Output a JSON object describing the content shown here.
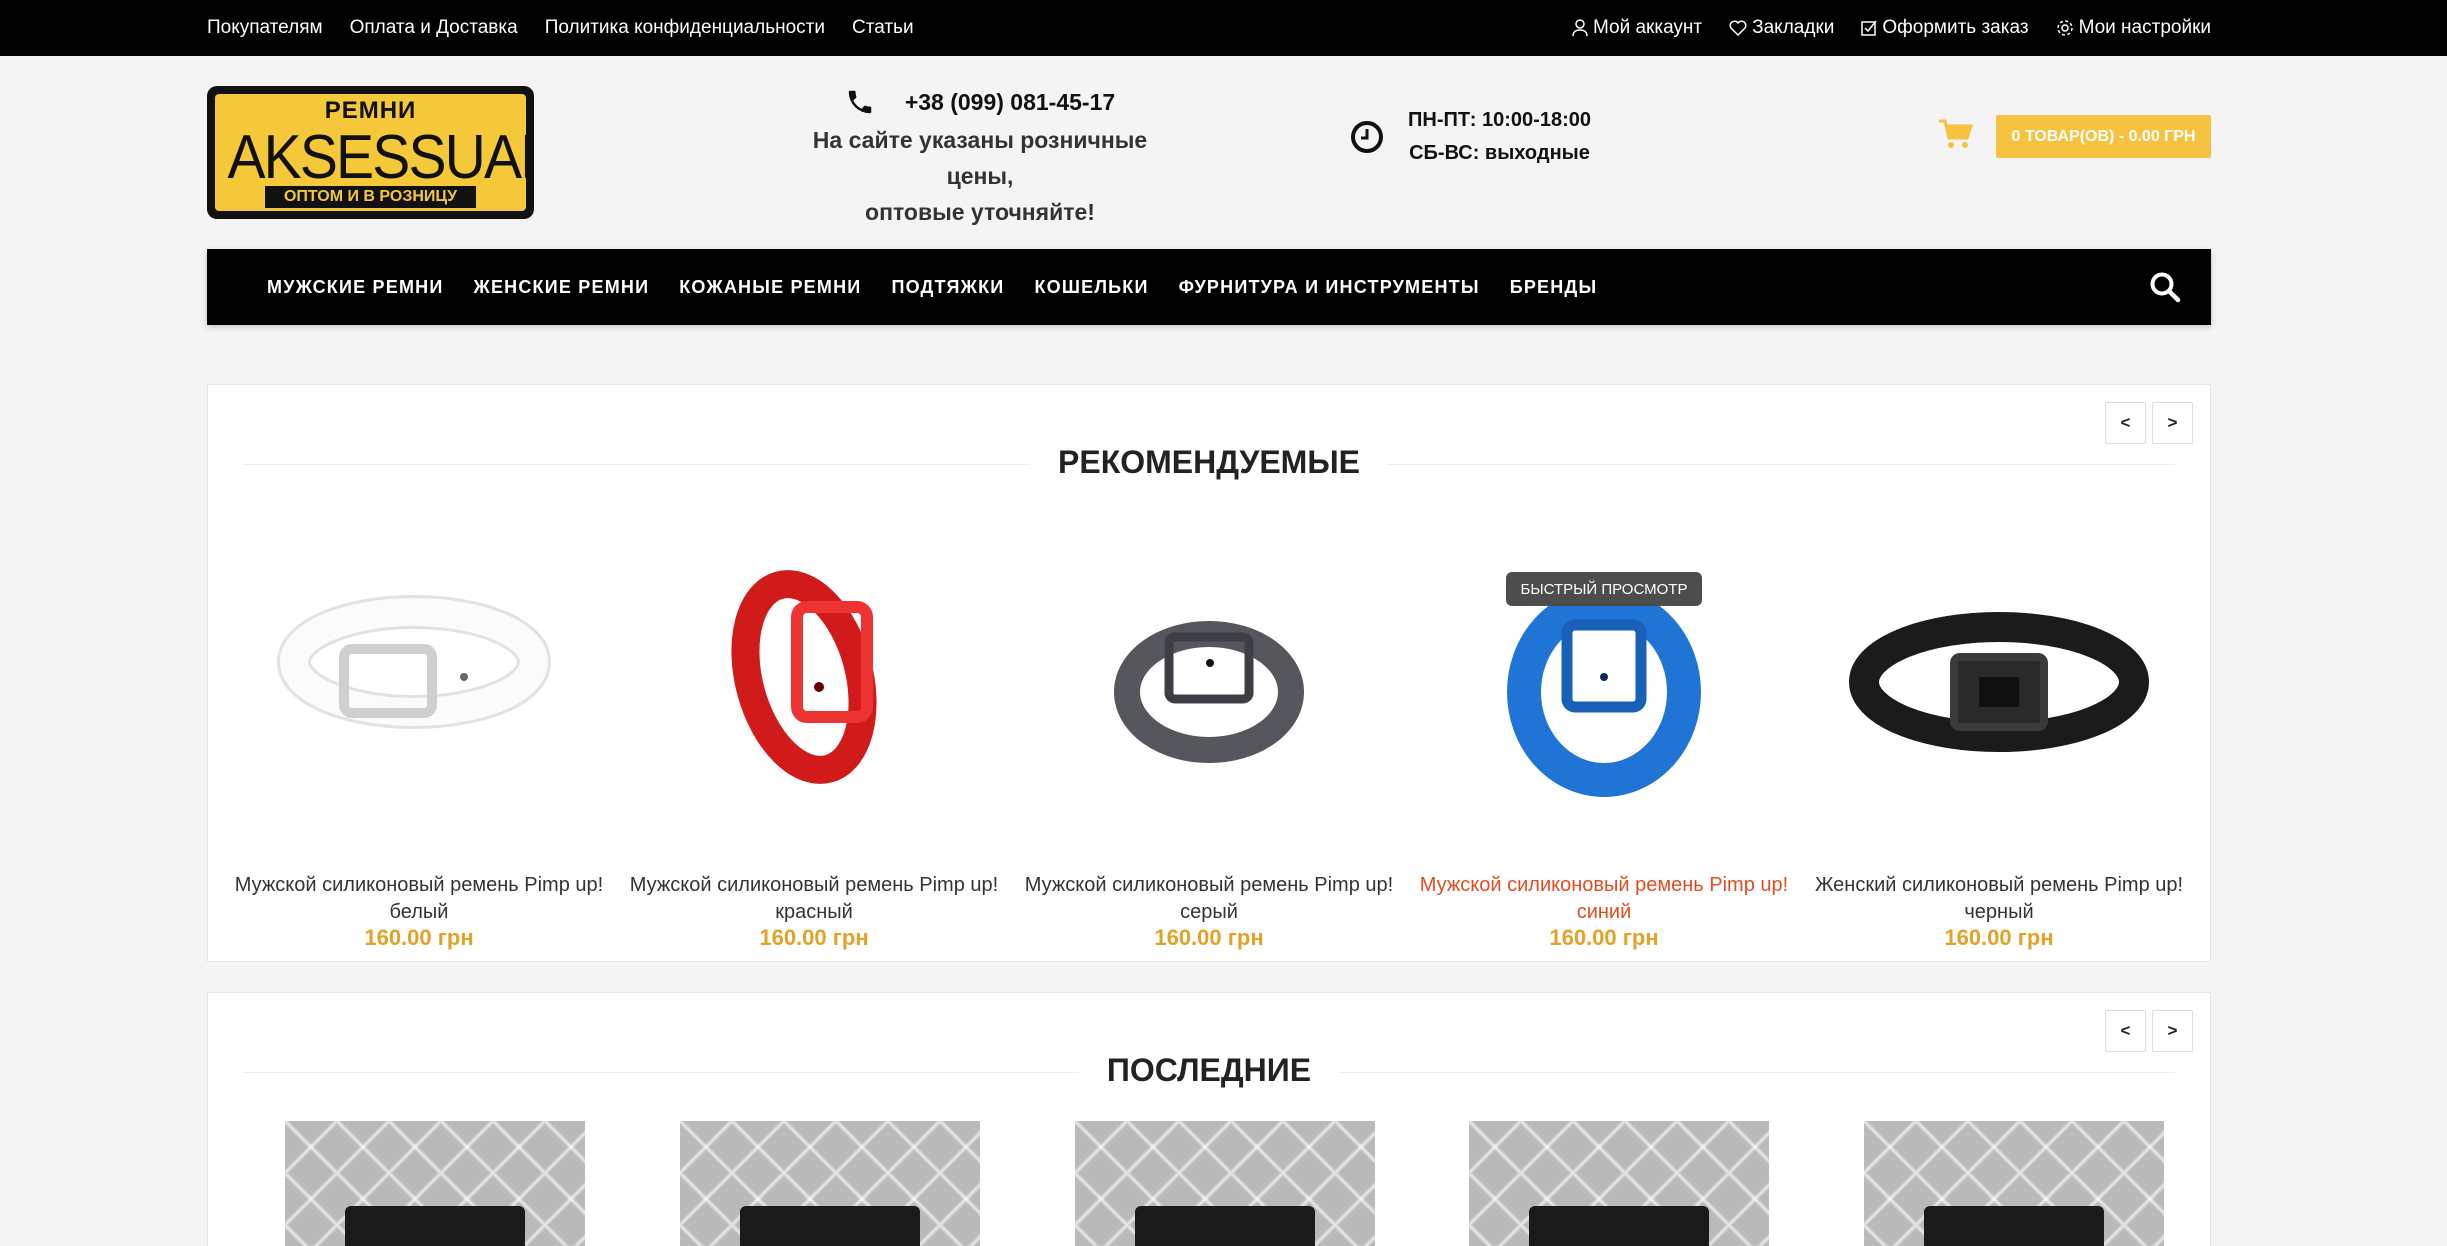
{
  "topbar": {
    "left_links": [
      "Покупателям",
      "Оплата и Доставка",
      "Политика конфиденциальности",
      "Статьи"
    ],
    "account": "Мой аккаунт",
    "bookmarks": "Закладки",
    "checkout": "Оформить заказ",
    "settings": "Мои настройки"
  },
  "logo": {
    "top": "РЕМНИ",
    "brand": "AKSESSUAR",
    "bottom": "ОПТОМ И В РОЗНИЦУ"
  },
  "contact": {
    "phone": "+38 (099) 081-45-17",
    "note_line1": "На сайте указаны розничные цены,",
    "note_line2": "оптовые уточняйте!"
  },
  "hours": {
    "weekdays": "ПН-ПТ: 10:00-18:00",
    "weekend": "СБ-ВС: выходные"
  },
  "cart": {
    "label": "0 ТОВАР(ОВ) - 0.00 ГРН"
  },
  "nav": {
    "items": [
      "МУЖСКИЕ РЕМНИ",
      "ЖЕНСКИЕ РЕМНИ",
      "КОЖАНЫЕ РЕМНИ",
      "ПОДТЯЖКИ",
      "КОШЕЛЬКИ",
      "ФУРНИТУРА И ИНСТРУМЕНТЫ",
      "БРЕНДЫ"
    ]
  },
  "featured": {
    "title": "РЕКОМЕНДУЕМЫЕ",
    "prev": "<",
    "next": ">",
    "quick_view": "БЫСТРЫЙ ПРОСМОТР",
    "products": [
      {
        "name": "Мужской силиконовый ремень Pimp up! белый",
        "price": "160.00 грн",
        "color": "#f4f4f4"
      },
      {
        "name": "Мужской силиконовый ремень Pimp up! красный",
        "price": "160.00 грн",
        "color": "#e0201e"
      },
      {
        "name": "Мужской силиконовый ремень Pimp up! серый",
        "price": "160.00 грн",
        "color": "#55575c"
      },
      {
        "name": "Мужской силиконовый ремень Pimp up! синий",
        "price": "160.00 грн",
        "color": "#1f74d6"
      },
      {
        "name": "Женский силиконовый ремень Pimp up! черный",
        "price": "160.00 грн",
        "color": "#1b1b1b"
      }
    ]
  },
  "latest": {
    "title": "ПОСЛЕДНИЕ",
    "prev": "<",
    "next": ">"
  },
  "colors": {
    "accent": "#f5c340",
    "price": "#e2a227",
    "hover_link": "#e04e20"
  }
}
